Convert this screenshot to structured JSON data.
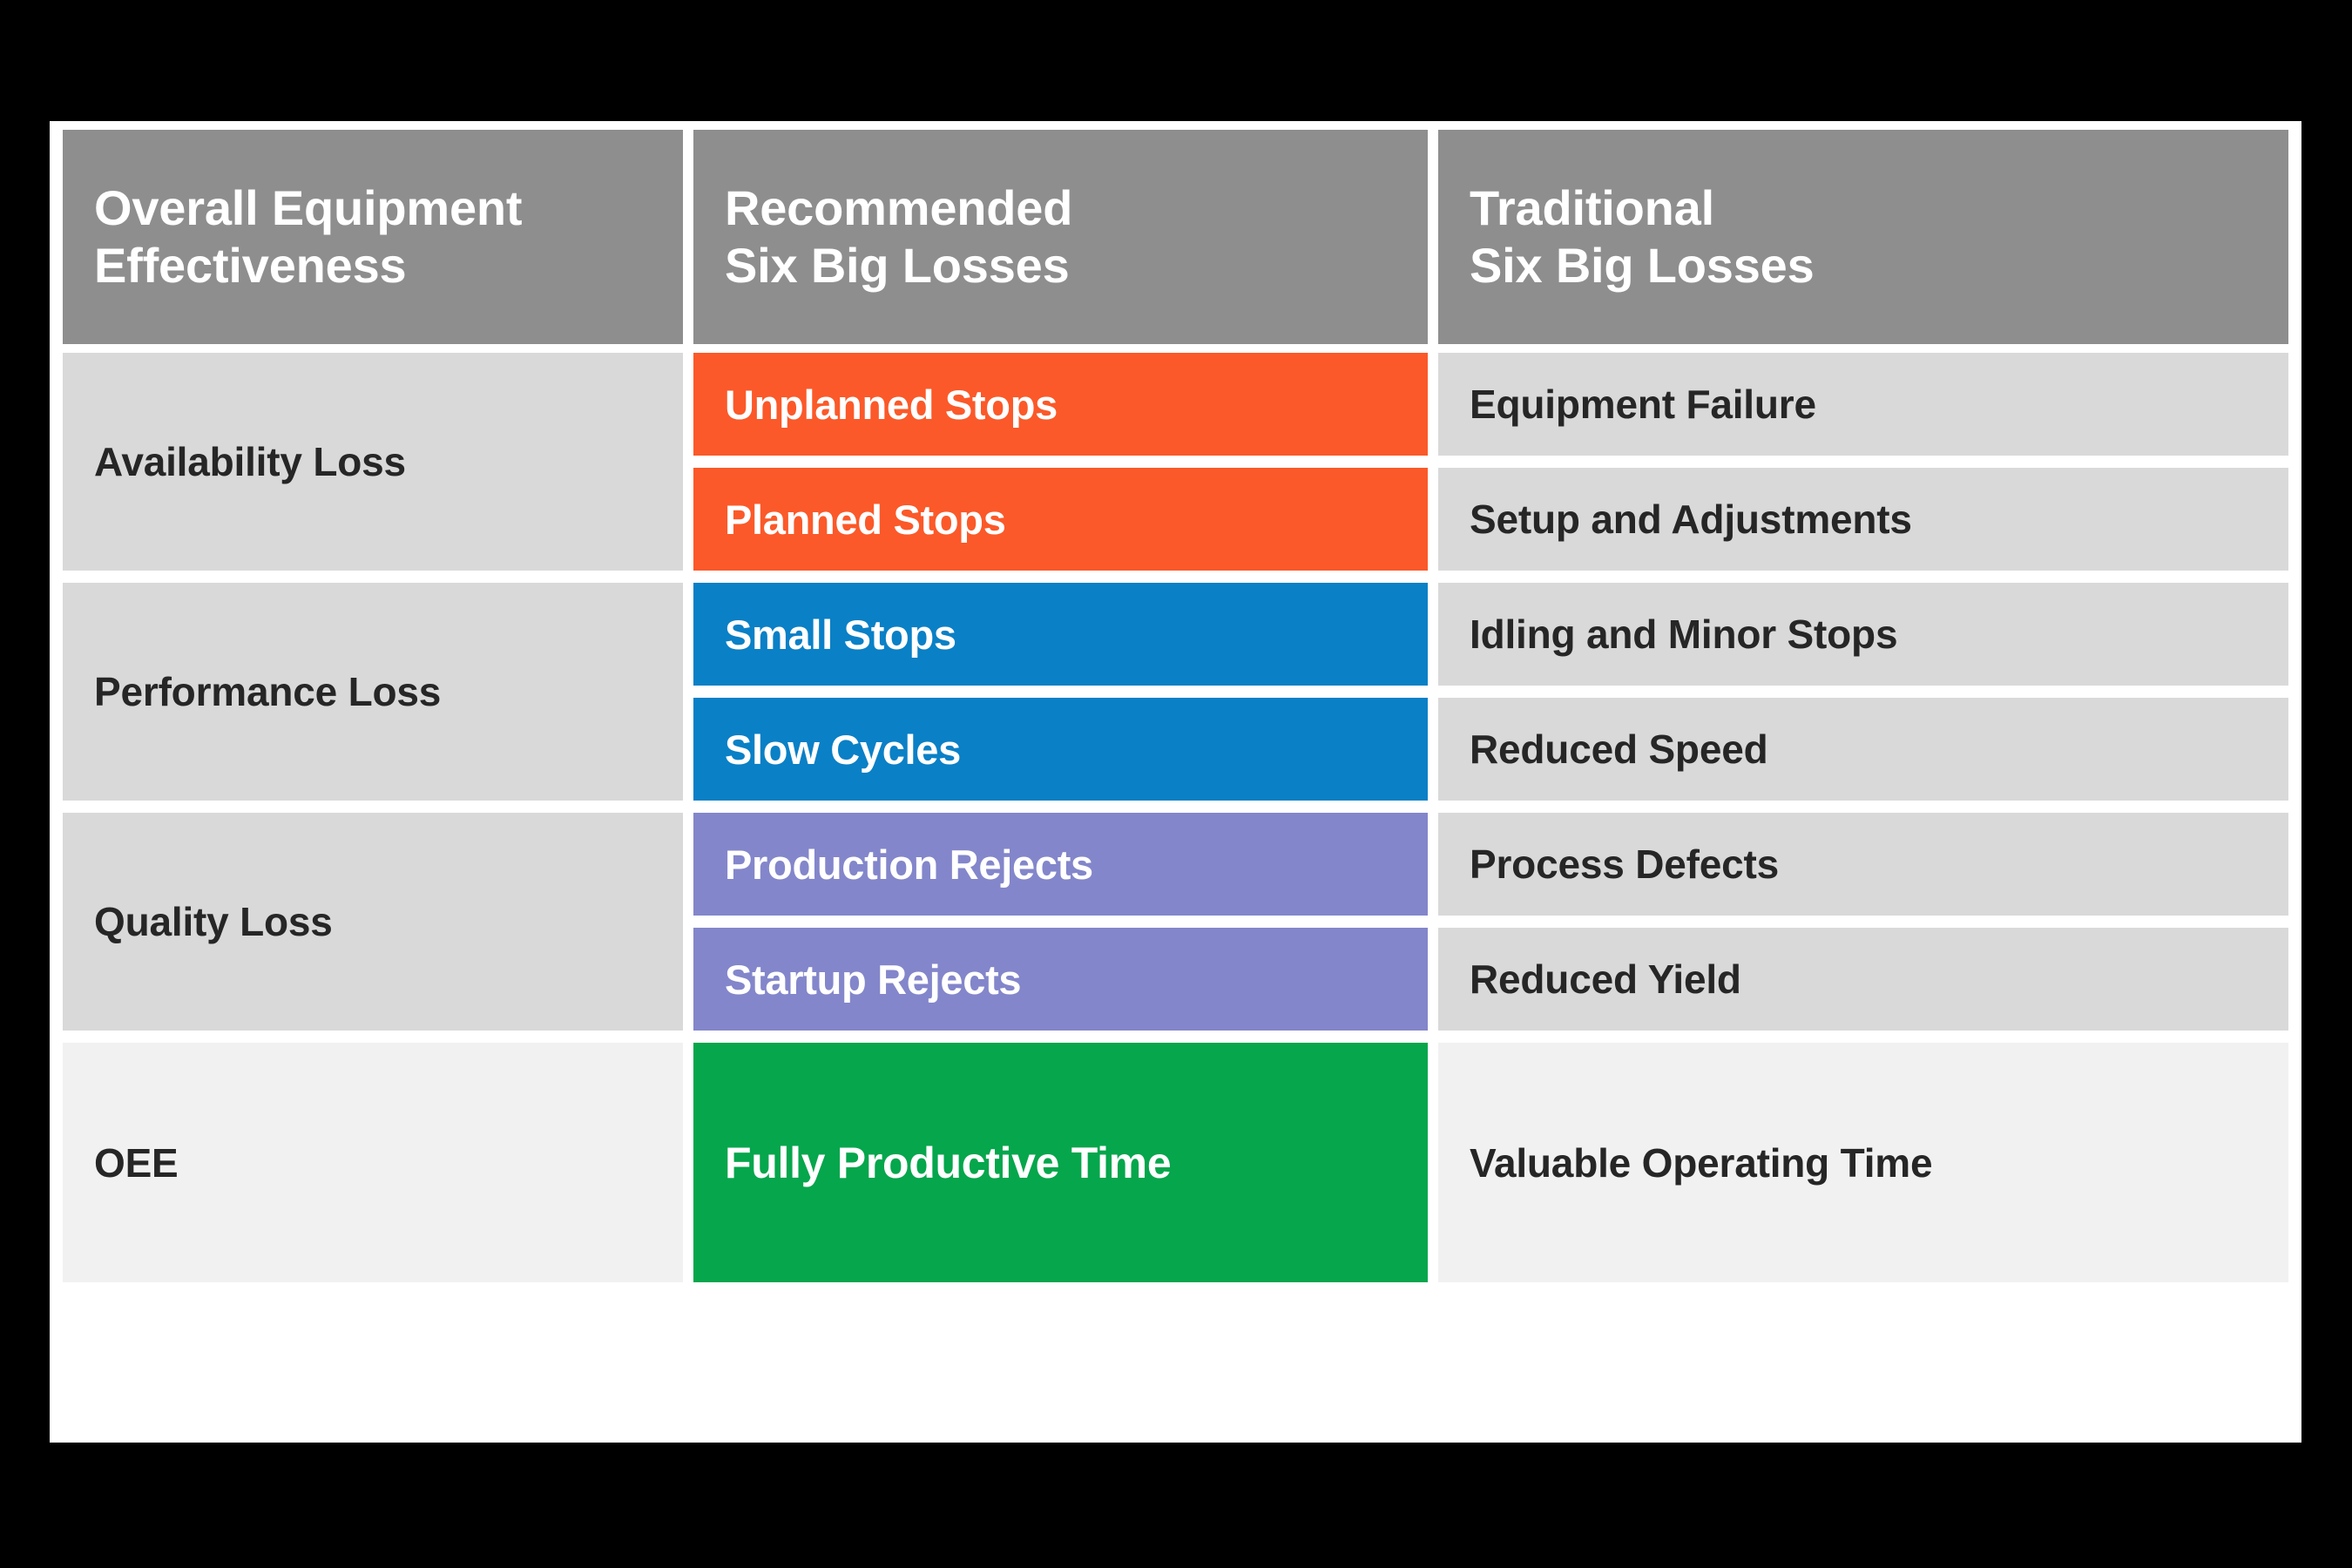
{
  "colors": {
    "page_background": "#000000",
    "card_background": "#ffffff",
    "header_gray": "#8e8e8e",
    "cell_gray": "#d9d9d9",
    "oee_row_gray": "#f1f1f1",
    "availability_orange": "#fb5929",
    "performance_blue": "#0a80c6",
    "quality_purple": "#8386ca",
    "oee_green": "#05a64c",
    "text_dark": "#262626",
    "text_light": "#ffffff"
  },
  "table": {
    "headers": {
      "col1_line1": "Overall Equipment",
      "col1_line2": "Effectiveness",
      "col2_line1": "Recommended",
      "col2_line2": "Six Big Losses",
      "col3_line1": "Traditional",
      "col3_line2": "Six Big Losses"
    },
    "categories": [
      {
        "label": "Availability Loss"
      },
      {
        "label": "Performance Loss"
      },
      {
        "label": "Quality Loss"
      },
      {
        "label": "OEE"
      }
    ],
    "rows": [
      {
        "category": "Availability Loss",
        "recommended": "Unplanned Stops",
        "traditional": "Equipment Failure",
        "color": "#fb5929"
      },
      {
        "category": "Availability Loss",
        "recommended": "Planned Stops",
        "traditional": "Setup and Adjustments",
        "color": "#fb5929"
      },
      {
        "category": "Performance Loss",
        "recommended": "Small Stops",
        "traditional": "Idling and Minor Stops",
        "color": "#0a80c6"
      },
      {
        "category": "Performance Loss",
        "recommended": "Slow Cycles",
        "traditional": "Reduced Speed",
        "color": "#0a80c6"
      },
      {
        "category": "Quality Loss",
        "recommended": "Production Rejects",
        "traditional": "Process Defects",
        "color": "#8386ca"
      },
      {
        "category": "Quality Loss",
        "recommended": "Startup Rejects",
        "traditional": "Reduced Yield",
        "color": "#8386ca"
      },
      {
        "category": "OEE",
        "recommended": "Fully Productive Time",
        "traditional": "Valuable Operating Time",
        "color": "#05a64c"
      }
    ]
  }
}
